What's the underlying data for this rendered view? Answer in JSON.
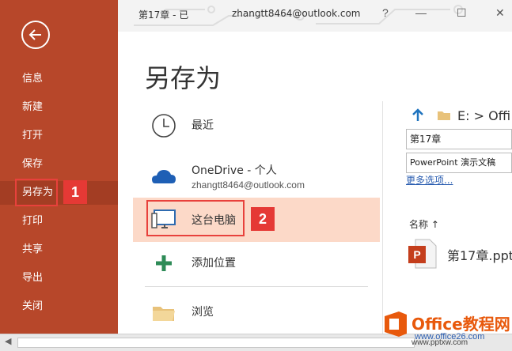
{
  "window": {
    "title": "第17章 - 已",
    "account": "zhangtt8464@outlook.com",
    "help_label": "?",
    "minimize_label": "—",
    "maximize_label": "☐",
    "close_label": "✕"
  },
  "sidebar": {
    "items": [
      {
        "label": "信息"
      },
      {
        "label": "新建"
      },
      {
        "label": "打开"
      },
      {
        "label": "保存"
      },
      {
        "label": "另存为"
      },
      {
        "label": "打印"
      },
      {
        "label": "共享"
      },
      {
        "label": "导出"
      },
      {
        "label": "关闭"
      }
    ],
    "active_index": 4
  },
  "callouts": {
    "one": "1",
    "two": "2"
  },
  "main": {
    "title": "另存为",
    "options": [
      {
        "label": "最近",
        "icon": "clock-icon"
      },
      {
        "label": "OneDrive - 个人",
        "sublabel": "zhangtt8464@outlook.com",
        "icon": "cloud-icon"
      },
      {
        "label": "这台电脑",
        "icon": "computer-icon"
      },
      {
        "label": "添加位置",
        "icon": "plus-icon"
      },
      {
        "label": "浏览",
        "icon": "folder-icon"
      }
    ]
  },
  "right": {
    "path": "E: > Offi",
    "filename": "第17章",
    "filetype": "PowerPoint 演示文稿",
    "more_options": "更多选项...",
    "column_name": "名称 ↑",
    "file": "第17章.ppt"
  },
  "watermark": {
    "brand": "Office教程网",
    "url": "www.office26.com",
    "url2": "www.pptxw.com"
  },
  "colors": {
    "sidebar": "#b7472a",
    "selected": "#fcd9c8",
    "callout": "#e53935"
  }
}
